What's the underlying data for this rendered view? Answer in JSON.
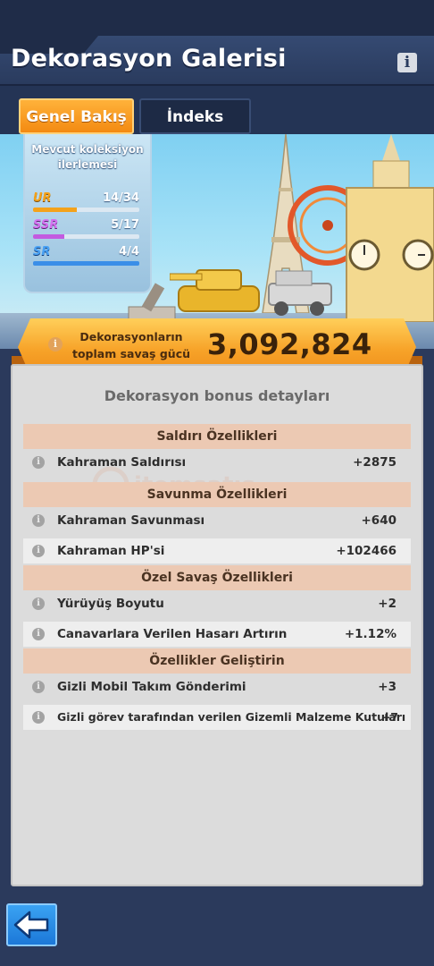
{
  "header": {
    "title": "Dekorasyon Galerisi",
    "info_icon": "info-icon"
  },
  "tabs": [
    {
      "label": "Genel Bakış",
      "active": true
    },
    {
      "label": "İndeks",
      "active": false
    }
  ],
  "collection": {
    "title": "Mevcut koleksiyon ilerlemesi",
    "rarities": [
      {
        "label": "UR",
        "value": "14/34",
        "progress": 0.41,
        "color": "#f4a21a"
      },
      {
        "label": "SSR",
        "value": "5/17",
        "progress": 0.29,
        "color": "#c35be0"
      },
      {
        "label": "SR",
        "value": "4/4",
        "progress": 1.0,
        "color": "#3a8ee8"
      }
    ]
  },
  "power": {
    "label": "Dekorasyonların toplam savaş gücü",
    "value": "3,092,824"
  },
  "details": {
    "title": "Dekorasyon bonus detayları",
    "sections": [
      {
        "name": "Saldırı Özellikleri",
        "rows": [
          {
            "label": "Kahraman Saldırısı",
            "value": "+2875"
          }
        ]
      },
      {
        "name": "Savunma Özellikleri",
        "rows": [
          {
            "label": "Kahraman Savunması",
            "value": "+640"
          },
          {
            "label": "Kahraman HP'si",
            "value": "+102466"
          }
        ]
      },
      {
        "name": "Özel Savaş Özellikleri",
        "rows": [
          {
            "label": "Yürüyüş Boyutu",
            "value": "+2"
          },
          {
            "label": "Canavarlara Verilen Hasarı Artırın",
            "value": "+1.12%"
          }
        ]
      },
      {
        "name": "Özellikler Geliştirin",
        "rows": [
          {
            "label": "Gizli Mobil Takım Gönderimi",
            "value": "+3"
          },
          {
            "label": "Gizli görev tarafından verilen Gizemli Malzeme Kutuları",
            "value": "+7"
          }
        ]
      }
    ]
  },
  "watermark": "itemsatış",
  "back_icon": "back-arrow-icon"
}
